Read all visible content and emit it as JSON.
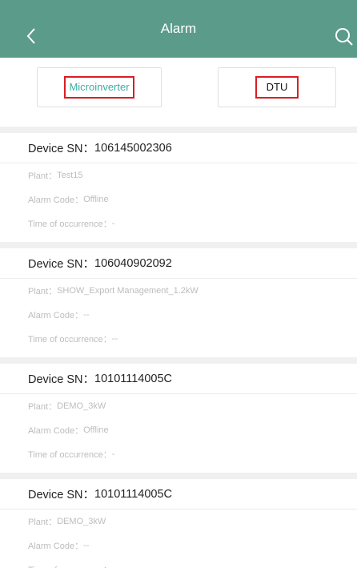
{
  "header": {
    "title": "Alarm",
    "back_icon": "chevron-left-icon",
    "search_icon": "search-icon"
  },
  "tabs": [
    {
      "label": "Microinverter",
      "active": true
    },
    {
      "label": "DTU",
      "active": false
    }
  ],
  "labels": {
    "device_sn": "Device SN：",
    "plant": "Plant：",
    "alarm_code": "Alarm Code：",
    "time": "Time of occurrence："
  },
  "devices": [
    {
      "sn": "106145002306",
      "plant": "Test15",
      "alarm_code": "Offline",
      "time": "-"
    },
    {
      "sn": "106040902092",
      "plant": "SHOW_Export Management_1.2kW",
      "alarm_code": "--",
      "time": "--"
    },
    {
      "sn": "10101114005C",
      "plant": "DEMO_3kW",
      "alarm_code": "Offline",
      "time": "-"
    },
    {
      "sn": "10101114005C",
      "plant": "DEMO_3kW",
      "alarm_code": "--",
      "time": "--"
    }
  ],
  "colors": {
    "header_bg": "#5b9b8a",
    "active_tab_text": "#3aaea0",
    "highlight_border": "#d81e24"
  }
}
